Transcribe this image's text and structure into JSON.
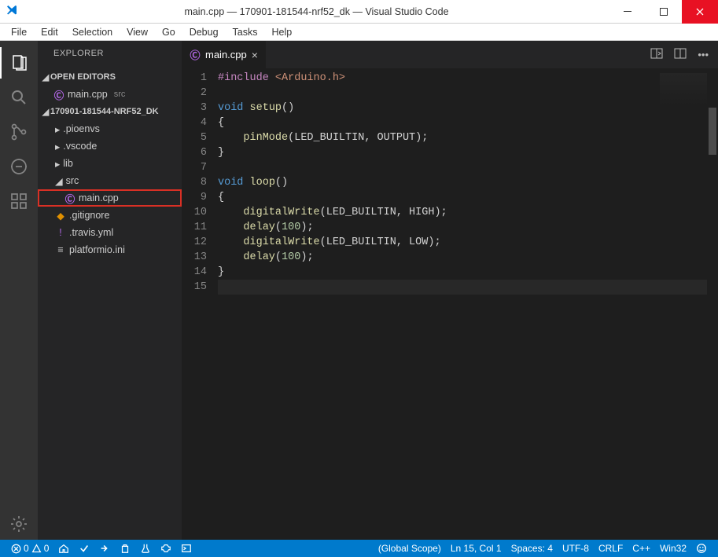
{
  "window": {
    "title": "main.cpp — 170901-181544-nrf52_dk — Visual Studio Code"
  },
  "menubar": [
    "File",
    "Edit",
    "Selection",
    "View",
    "Go",
    "Debug",
    "Tasks",
    "Help"
  ],
  "activity": {
    "items": [
      "explorer",
      "search",
      "scm",
      "debug",
      "extensions"
    ],
    "settings": "settings"
  },
  "sidebar": {
    "title": "EXPLORER",
    "sections": {
      "openEditors": {
        "label": "OPEN EDITORS",
        "items": [
          {
            "icon": "cpp",
            "name": "main.cpp",
            "tail": "src"
          }
        ]
      },
      "workspace": {
        "label": "170901-181544-NRF52_DK",
        "tree": [
          {
            "kind": "folder",
            "expanded": false,
            "name": ".pioenvs"
          },
          {
            "kind": "folder",
            "expanded": false,
            "name": ".vscode"
          },
          {
            "kind": "folder",
            "expanded": false,
            "name": "lib"
          },
          {
            "kind": "folder",
            "expanded": true,
            "name": "src",
            "children": [
              {
                "kind": "file",
                "icon": "cpp",
                "name": "main.cpp",
                "selected": true
              }
            ]
          },
          {
            "kind": "file",
            "icon": "git",
            "name": ".gitignore"
          },
          {
            "kind": "file",
            "icon": "travis",
            "name": ".travis.yml"
          },
          {
            "kind": "file",
            "icon": "ini",
            "name": "platformio.ini"
          }
        ]
      }
    }
  },
  "editor": {
    "tab": {
      "icon": "cpp",
      "name": "main.cpp"
    },
    "code": [
      {
        "n": 1,
        "seg": [
          [
            "pp",
            "#include"
          ],
          [
            "",
            " "
          ],
          [
            "str",
            "<Arduino.h>"
          ]
        ]
      },
      {
        "n": 2,
        "seg": []
      },
      {
        "n": 3,
        "seg": [
          [
            "kw",
            "void"
          ],
          [
            "",
            " "
          ],
          [
            "fn",
            "setup"
          ],
          [
            "",
            "()"
          ]
        ]
      },
      {
        "n": 4,
        "seg": [
          [
            "",
            "{"
          ]
        ]
      },
      {
        "n": 5,
        "seg": [
          [
            "",
            "    "
          ],
          [
            "fn",
            "pinMode"
          ],
          [
            "",
            "(LED_BUILTIN, OUTPUT);"
          ]
        ]
      },
      {
        "n": 6,
        "seg": [
          [
            "",
            "}"
          ]
        ]
      },
      {
        "n": 7,
        "seg": []
      },
      {
        "n": 8,
        "seg": [
          [
            "kw",
            "void"
          ],
          [
            "",
            " "
          ],
          [
            "fn",
            "loop"
          ],
          [
            "",
            "()"
          ]
        ]
      },
      {
        "n": 9,
        "seg": [
          [
            "",
            "{"
          ]
        ]
      },
      {
        "n": 10,
        "seg": [
          [
            "",
            "    "
          ],
          [
            "fn",
            "digitalWrite"
          ],
          [
            "",
            "(LED_BUILTIN, HIGH);"
          ]
        ]
      },
      {
        "n": 11,
        "seg": [
          [
            "",
            "    "
          ],
          [
            "fn",
            "delay"
          ],
          [
            "",
            "("
          ],
          [
            "num",
            "100"
          ],
          [
            "",
            ");"
          ]
        ]
      },
      {
        "n": 12,
        "seg": [
          [
            "",
            "    "
          ],
          [
            "fn",
            "digitalWrite"
          ],
          [
            "",
            "(LED_BUILTIN, LOW);"
          ]
        ]
      },
      {
        "n": 13,
        "seg": [
          [
            "",
            "    "
          ],
          [
            "fn",
            "delay"
          ],
          [
            "",
            "("
          ],
          [
            "num",
            "100"
          ],
          [
            "",
            ");"
          ]
        ]
      },
      {
        "n": 14,
        "seg": [
          [
            "",
            "}"
          ]
        ]
      },
      {
        "n": 15,
        "seg": [],
        "current": true
      }
    ]
  },
  "status": {
    "left": {
      "errors": "0",
      "warnings": "0"
    },
    "right": {
      "scope": "(Global Scope)",
      "lncol": "Ln 15, Col 1",
      "spaces": "Spaces: 4",
      "encoding": "UTF-8",
      "eol": "CRLF",
      "lang": "C++",
      "platform": "Win32"
    }
  }
}
